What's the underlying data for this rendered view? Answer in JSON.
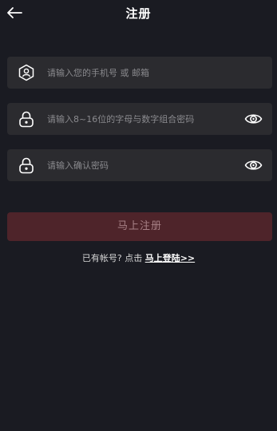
{
  "header": {
    "title": "注册"
  },
  "form": {
    "account_placeholder": "请输入您的手机号 或 邮箱",
    "password_placeholder": "请输入8~16位的字母与数字组合密码",
    "confirm_placeholder": "请输入确认密码",
    "submit_label": "马上注册"
  },
  "footer": {
    "prompt": "已有帐号? 点击 ",
    "login_link": "马上登陆>>"
  },
  "icons": {
    "back": "arrow-left-icon",
    "account": "user-badge-icon",
    "password": "lock-icon",
    "confirm": "lock-icon",
    "eye": "eye-icon"
  },
  "colors": {
    "background": "#1a1b22",
    "field": "#2b2b2f",
    "button": "#4e242a",
    "button_text": "#a78086"
  }
}
